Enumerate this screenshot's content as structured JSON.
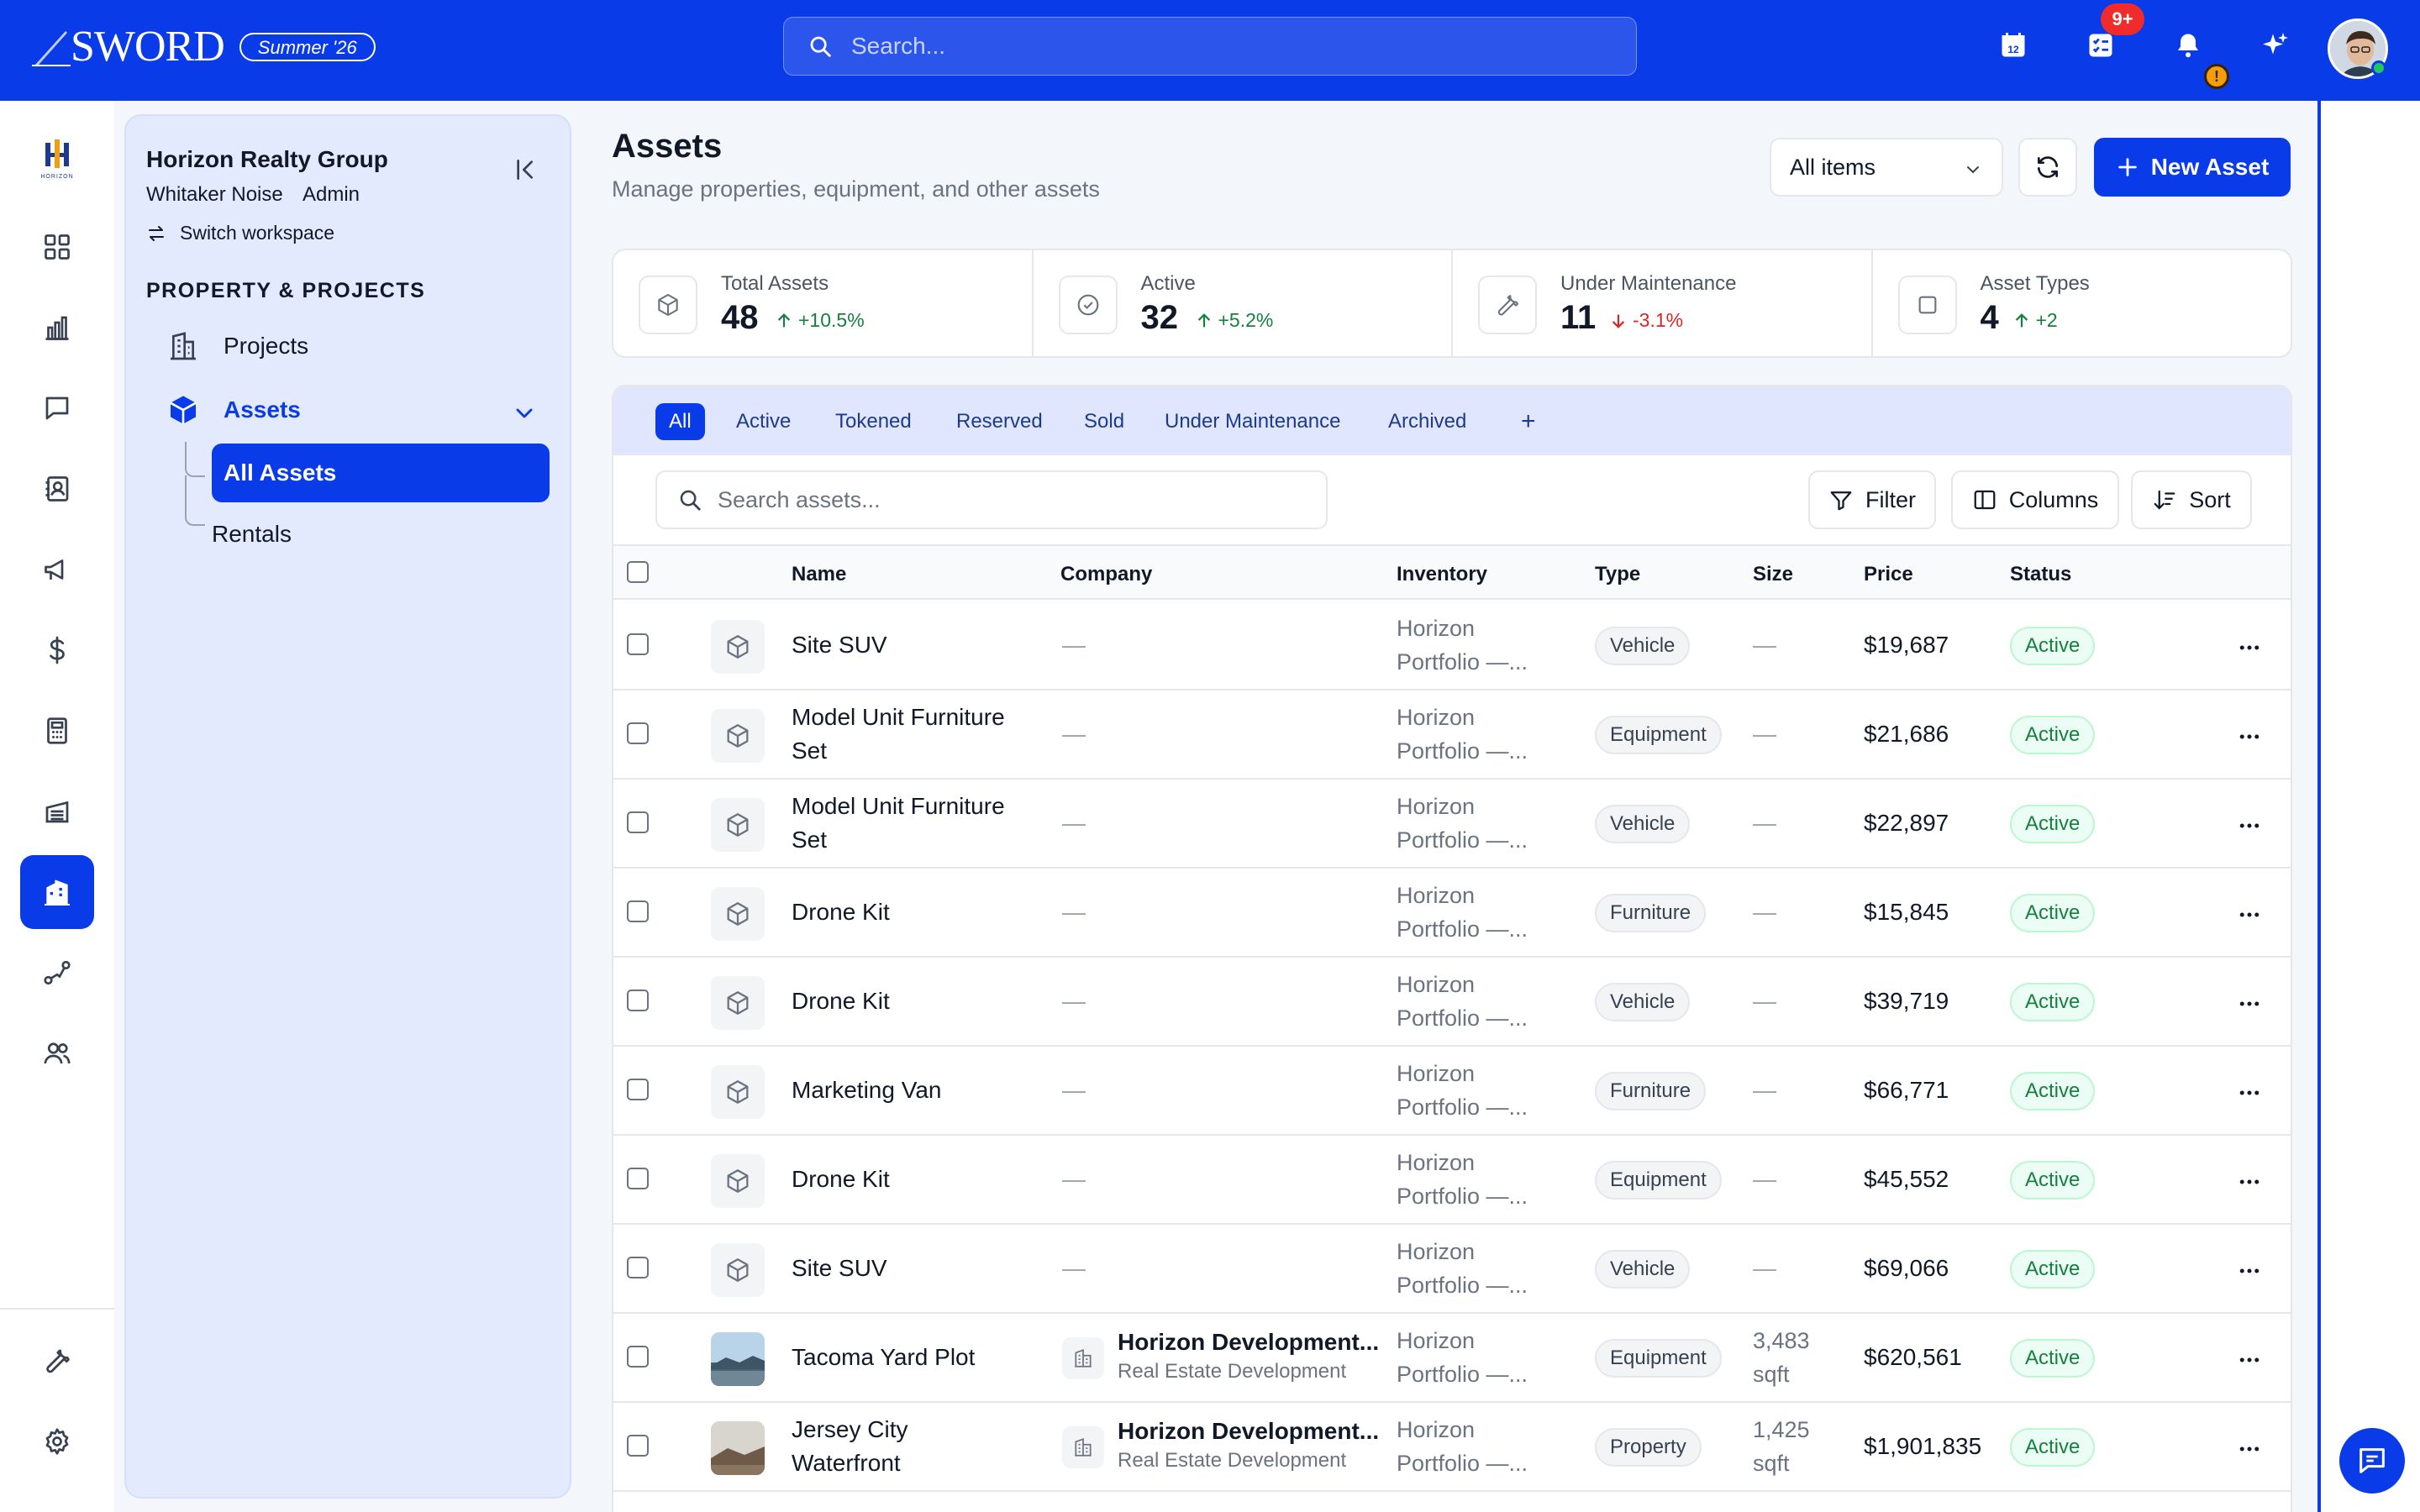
{
  "topbar": {
    "brand": "SWORD",
    "edition": "Summer '26",
    "search_placeholder": "Search...",
    "calendar_day": "12",
    "tasks_badge": "9+",
    "notif_badge": "!"
  },
  "workspace": {
    "rail_logo_text": "HORIZON",
    "name": "Horizon Realty Group",
    "user": "Whitaker Noise",
    "role": "Admin",
    "switch_label": "Switch workspace",
    "section": "PROPERTY & PROJECTS",
    "nav": {
      "projects": "Projects",
      "assets": "Assets",
      "all_assets": "All Assets",
      "rentals": "Rentals"
    }
  },
  "page": {
    "title": "Assets",
    "subtitle": "Manage properties, equipment, and other assets",
    "filter_select": "All items",
    "new_button": "New Asset"
  },
  "stats": [
    {
      "label": "Total Assets",
      "value": "48",
      "delta": "+10.5%",
      "trend": "up",
      "icon": "cube-icon"
    },
    {
      "label": "Active",
      "value": "32",
      "delta": "+5.2%",
      "trend": "up",
      "icon": "check-circle-icon"
    },
    {
      "label": "Under Maintenance",
      "value": "11",
      "delta": "-3.1%",
      "trend": "down",
      "icon": "wrench-icon"
    },
    {
      "label": "Asset Types",
      "value": "4",
      "delta": "+2",
      "trend": "up",
      "icon": "square-icon"
    }
  ],
  "tabs": [
    "All",
    "Active",
    "Tokened",
    "Reserved",
    "Sold",
    "Under Maintenance",
    "Archived",
    "+"
  ],
  "table_tools": {
    "search_placeholder": "Search assets...",
    "filter": "Filter",
    "columns": "Columns",
    "sort": "Sort"
  },
  "columns": [
    "Name",
    "Company",
    "Inventory",
    "Type",
    "Size",
    "Price",
    "Status"
  ],
  "rows": [
    {
      "name1": "Site SUV",
      "name2": "",
      "company": "—",
      "company_sub": "",
      "inv1": "Horizon",
      "inv2": "Portfolio —...",
      "type": "Vehicle",
      "size1": "—",
      "size2": "",
      "price": "$19,687",
      "status": "Active",
      "thumb": "cube"
    },
    {
      "name1": "Model Unit Furniture",
      "name2": "Set",
      "company": "—",
      "company_sub": "",
      "inv1": "Horizon",
      "inv2": "Portfolio —...",
      "type": "Equipment",
      "size1": "—",
      "size2": "",
      "price": "$21,686",
      "status": "Active",
      "thumb": "cube"
    },
    {
      "name1": "Model Unit Furniture",
      "name2": "Set",
      "company": "—",
      "company_sub": "",
      "inv1": "Horizon",
      "inv2": "Portfolio —...",
      "type": "Vehicle",
      "size1": "—",
      "size2": "",
      "price": "$22,897",
      "status": "Active",
      "thumb": "cube"
    },
    {
      "name1": "Drone Kit",
      "name2": "",
      "company": "—",
      "company_sub": "",
      "inv1": "Horizon",
      "inv2": "Portfolio —...",
      "type": "Furniture",
      "size1": "—",
      "size2": "",
      "price": "$15,845",
      "status": "Active",
      "thumb": "cube"
    },
    {
      "name1": "Drone Kit",
      "name2": "",
      "company": "—",
      "company_sub": "",
      "inv1": "Horizon",
      "inv2": "Portfolio —...",
      "type": "Vehicle",
      "size1": "—",
      "size2": "",
      "price": "$39,719",
      "status": "Active",
      "thumb": "cube"
    },
    {
      "name1": "Marketing Van",
      "name2": "",
      "company": "—",
      "company_sub": "",
      "inv1": "Horizon",
      "inv2": "Portfolio —...",
      "type": "Furniture",
      "size1": "—",
      "size2": "",
      "price": "$66,771",
      "status": "Active",
      "thumb": "cube"
    },
    {
      "name1": "Drone Kit",
      "name2": "",
      "company": "—",
      "company_sub": "",
      "inv1": "Horizon",
      "inv2": "Portfolio —...",
      "type": "Equipment",
      "size1": "—",
      "size2": "",
      "price": "$45,552",
      "status": "Active",
      "thumb": "cube"
    },
    {
      "name1": "Site SUV",
      "name2": "",
      "company": "—",
      "company_sub": "",
      "inv1": "Horizon",
      "inv2": "Portfolio —...",
      "type": "Vehicle",
      "size1": "—",
      "size2": "",
      "price": "$69,066",
      "status": "Active",
      "thumb": "cube"
    },
    {
      "name1": "Tacoma Yard Plot",
      "name2": "",
      "company": "Horizon Development...",
      "company_sub": "Real Estate Development",
      "inv1": "Horizon",
      "inv2": "Portfolio —...",
      "type": "Equipment",
      "size1": "3,483",
      "size2": "sqft",
      "price": "$620,561",
      "status": "Active",
      "thumb": "photo"
    },
    {
      "name1": "Jersey City",
      "name2": "Waterfront",
      "company": "Horizon Development...",
      "company_sub": "Real Estate Development",
      "inv1": "Horizon",
      "inv2": "Portfolio —...",
      "type": "Property",
      "size1": "1,425",
      "size2": "sqft",
      "price": "$1,901,835",
      "status": "Active",
      "thumb": "photo"
    }
  ],
  "colors": {
    "brand": "#0a3be8",
    "success": "#15803d",
    "danger": "#dc2626",
    "panel": "#e4eafd"
  }
}
